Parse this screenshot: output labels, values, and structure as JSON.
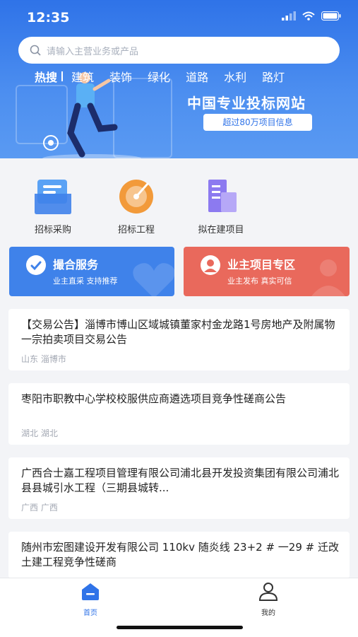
{
  "status_bar": {
    "time": "12:35"
  },
  "search": {
    "placeholder": "请输入主营业务或产品"
  },
  "hot": {
    "label": "热搜",
    "keywords": [
      "建筑",
      "装饰",
      "绿化",
      "道路",
      "水利",
      "路灯"
    ]
  },
  "banner": {
    "slogan": "中国专业投标网站",
    "badge": "超过80万项目信息"
  },
  "categories": [
    {
      "label": "招标采购",
      "icon": "folder-icon"
    },
    {
      "label": "招标工程",
      "icon": "target-icon"
    },
    {
      "label": "拟在建项目",
      "icon": "building-icon"
    }
  ],
  "services": [
    {
      "title": "撮合服务",
      "tags": "业主直采    支持推荐",
      "color": "#3f82ea",
      "icon": "handshake-icon"
    },
    {
      "title": "业主项目专区",
      "tags": "业主发布    真实可信",
      "color": "#e9695c",
      "icon": "user-icon"
    }
  ],
  "projects": [
    {
      "title": "【交易公告】淄博市博山区域城镇董家村金龙路1号房地产及附属物一宗拍卖项目交易公告",
      "location": "山东 淄博市"
    },
    {
      "title": "枣阳市职教中心学校校服供应商遴选项目竞争性磋商公告",
      "location": "湖北 湖北"
    },
    {
      "title": "广西合士嘉工程项目管理有限公司浦北县开发投资集团有限公司浦北县县城引水工程（三期县城转...",
      "location": "广西 广西"
    },
    {
      "title": "随州市宏图建设开发有限公司 110kv 随炎线 23+2 # 一29 # 迁改土建工程竞争性磋商",
      "location": ""
    }
  ],
  "tabbar": {
    "home": "首页",
    "mine": "我的"
  },
  "colors": {
    "primary": "#2f73e8",
    "accent_red": "#e9695c"
  }
}
